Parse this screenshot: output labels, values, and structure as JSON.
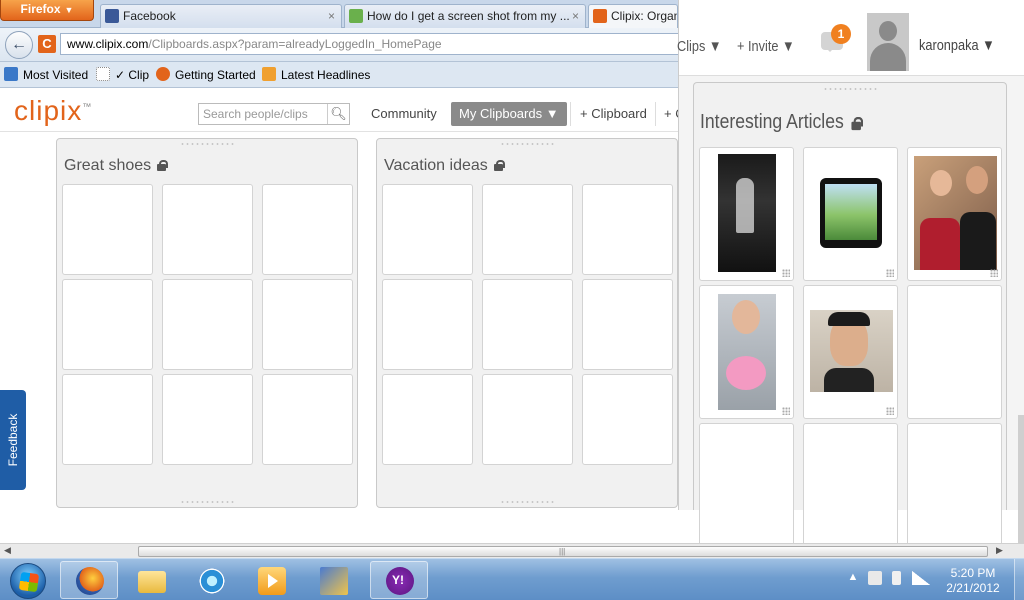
{
  "browser": {
    "menu_button": "Firefox",
    "tabs": [
      {
        "label": "Facebook",
        "color": "#3b5998",
        "close": "×"
      },
      {
        "label": "How do I get a screen shot from my ...",
        "color": "#6ab04c",
        "close": "×"
      },
      {
        "label": "Clipix: Organ",
        "color": "#e2641b"
      }
    ],
    "url_domain": "www.clipix.com",
    "url_path": "/Clipboards.aspx?param=alreadyLoggedIn_HomePage",
    "bookmarks": [
      {
        "label": "Most Visited",
        "color": "#3a78c8"
      },
      {
        "label": "✓ Clip",
        "color": "#ffffff"
      },
      {
        "label": "Getting Started",
        "color": "#e2641b"
      },
      {
        "label": "Latest Headlines",
        "color": "#f0a030"
      }
    ]
  },
  "clipix": {
    "logo": "clipix",
    "logo_tm": "™",
    "search_placeholder": "Search people/clips",
    "nav": {
      "community": "Community",
      "my_clipboards": "My Clipboards ▼",
      "add_clipboard": "+ Clipboard",
      "add_more": "+ C"
    },
    "boards": [
      {
        "title": "Great shoes"
      },
      {
        "title": "Vacation ideas"
      }
    ],
    "feedback": "Feedback"
  },
  "right_panel": {
    "nav_clips": "Clips ▼",
    "nav_invite": "+ Invite ▼",
    "notification_count": "1",
    "username": "karonpaka ▼",
    "board_title": "Interesting Articles"
  },
  "taskbar": {
    "time": "5:20 PM",
    "date": "2/21/2012"
  }
}
